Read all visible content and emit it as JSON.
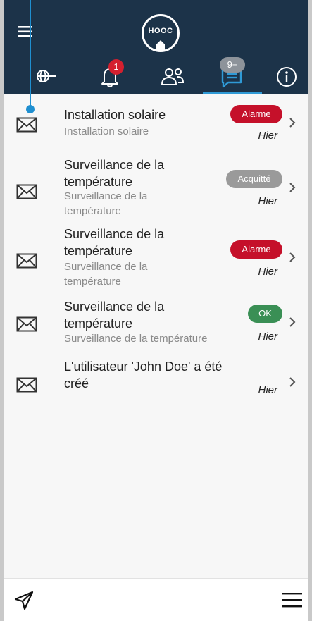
{
  "header": {
    "logo_text": "HOOC",
    "notifications_badge": "1",
    "messages_badge": "9+"
  },
  "messages": [
    {
      "title": "Installation solaire",
      "subtitle": "Installation solaire",
      "status": "Alarme",
      "date": "Hier"
    },
    {
      "title": "Surveillance de la température",
      "subtitle": "Surveillance de la température",
      "status": "Acquitté",
      "date": "Hier"
    },
    {
      "title": "Surveillance de la température",
      "subtitle": "Surveillance de la température",
      "status": "Alarme",
      "date": "Hier"
    },
    {
      "title": "Surveillance de la température",
      "subtitle": "Surveillance de la température",
      "status": "OK",
      "date": "Hier"
    },
    {
      "title": "L'utilisateur 'John Doe' a été créé",
      "subtitle": "",
      "status": "",
      "date": "Hier"
    }
  ],
  "icons": {
    "menu": "menu-icon",
    "globe": "globe-network-icon",
    "bell": "bell-icon",
    "users": "users-icon",
    "messages": "messages-icon",
    "info": "info-icon",
    "envelope": "envelope-icon",
    "chevron": "chevron-right-icon",
    "send": "send-icon",
    "hamburger": "hamburger-menu-icon"
  },
  "colors": {
    "header_bg": "#1c3349",
    "accent": "#2f9ad6",
    "alarm": "#c5102a",
    "ack": "#9a9a9a",
    "ok": "#3a8f55"
  }
}
